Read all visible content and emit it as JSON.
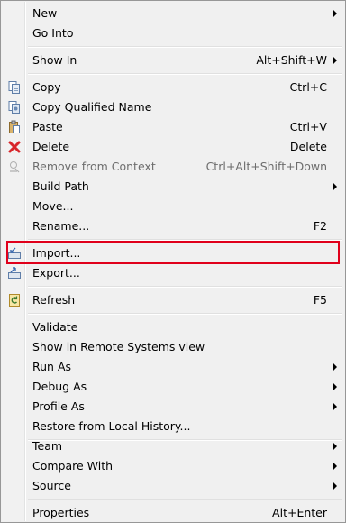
{
  "menu": {
    "items": {
      "new": {
        "label": "New"
      },
      "go_into": {
        "label": "Go Into"
      },
      "show_in": {
        "label": "Show In",
        "shortcut": "Alt+Shift+W"
      },
      "copy": {
        "label": "Copy",
        "shortcut": "Ctrl+C"
      },
      "copy_qualified": {
        "label": "Copy Qualified Name"
      },
      "paste": {
        "label": "Paste",
        "shortcut": "Ctrl+V"
      },
      "delete": {
        "label": "Delete",
        "shortcut": "Delete"
      },
      "remove_context": {
        "label": "Remove from Context",
        "shortcut": "Ctrl+Alt+Shift+Down"
      },
      "build_path": {
        "label": "Build Path"
      },
      "move": {
        "label": "Move..."
      },
      "rename": {
        "label": "Rename...",
        "shortcut": "F2"
      },
      "import": {
        "label": "Import..."
      },
      "export": {
        "label": "Export..."
      },
      "refresh": {
        "label": "Refresh",
        "shortcut": "F5"
      },
      "validate": {
        "label": "Validate"
      },
      "show_remote": {
        "label": "Show in Remote Systems view"
      },
      "run_as": {
        "label": "Run As"
      },
      "debug_as": {
        "label": "Debug As"
      },
      "profile_as": {
        "label": "Profile As"
      },
      "restore_history": {
        "label": "Restore from Local History..."
      },
      "team": {
        "label": "Team"
      },
      "compare_with": {
        "label": "Compare With"
      },
      "source": {
        "label": "Source"
      },
      "properties": {
        "label": "Properties",
        "shortcut": "Alt+Enter"
      }
    }
  },
  "colors": {
    "highlight_border": "#e0001b",
    "menu_background": "#f0f0f0",
    "disabled_text": "#6d6d6d"
  }
}
